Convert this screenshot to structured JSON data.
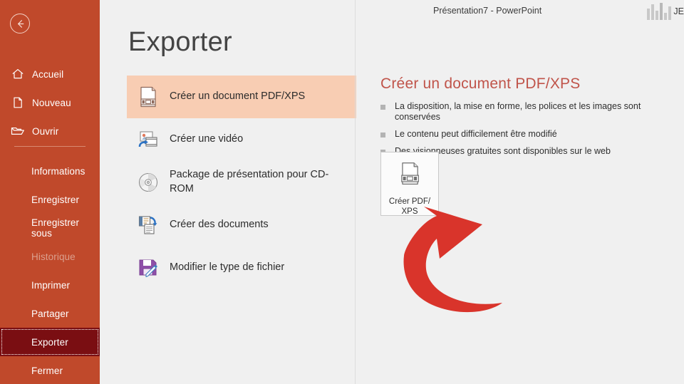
{
  "titlebar": {
    "document_title": "Présentation7  -  PowerPoint",
    "account_name": "JE",
    "back_icon": "back-arrow-icon"
  },
  "page": {
    "title": "Exporter"
  },
  "sidebar": {
    "background_color": "#c0492b",
    "selected_color": "#7a0e12",
    "top_items": [
      {
        "label": "Accueil",
        "icon": "home-icon"
      },
      {
        "label": "Nouveau",
        "icon": "new-document-icon"
      },
      {
        "label": "Ouvrir",
        "icon": "open-folder-icon"
      }
    ],
    "bottom_items": [
      {
        "label": "Informations",
        "state": "normal"
      },
      {
        "label": "Enregistrer",
        "state": "normal"
      },
      {
        "label": "Enregistrer sous",
        "state": "normal"
      },
      {
        "label": "Historique",
        "state": "disabled"
      },
      {
        "label": "Imprimer",
        "state": "normal"
      },
      {
        "label": "Partager",
        "state": "normal"
      },
      {
        "label": "Exporter",
        "state": "selected"
      },
      {
        "label": "Fermer",
        "state": "normal"
      }
    ]
  },
  "export_options": [
    {
      "label": "Créer un document PDF/XPS",
      "icon": "pdf-document-icon",
      "selected": true
    },
    {
      "label": "Créer une vidéo",
      "icon": "video-icon",
      "selected": false
    },
    {
      "label": "Package de présentation pour CD-ROM",
      "icon": "cd-rom-icon",
      "selected": false
    },
    {
      "label": "Créer des documents",
      "icon": "handouts-icon",
      "selected": false
    },
    {
      "label": "Modifier le type de fichier",
      "icon": "file-type-icon",
      "selected": false
    }
  ],
  "detail": {
    "heading": "Créer un document PDF/XPS",
    "heading_color": "#c0544a",
    "bullets": [
      "La disposition, la mise en forme, les polices et les images sont conservées",
      "Le contenu peut difficilement être modifié",
      "Des visionneuses gratuites sont disponibles sur le web"
    ],
    "action_button": {
      "line1": "Créer PDF/",
      "line2": "XPS",
      "icon": "pdf-document-icon"
    }
  },
  "annotation": {
    "type": "curved-arrow",
    "color": "#d9342b",
    "points_to": "create-pdf-xps-button"
  }
}
